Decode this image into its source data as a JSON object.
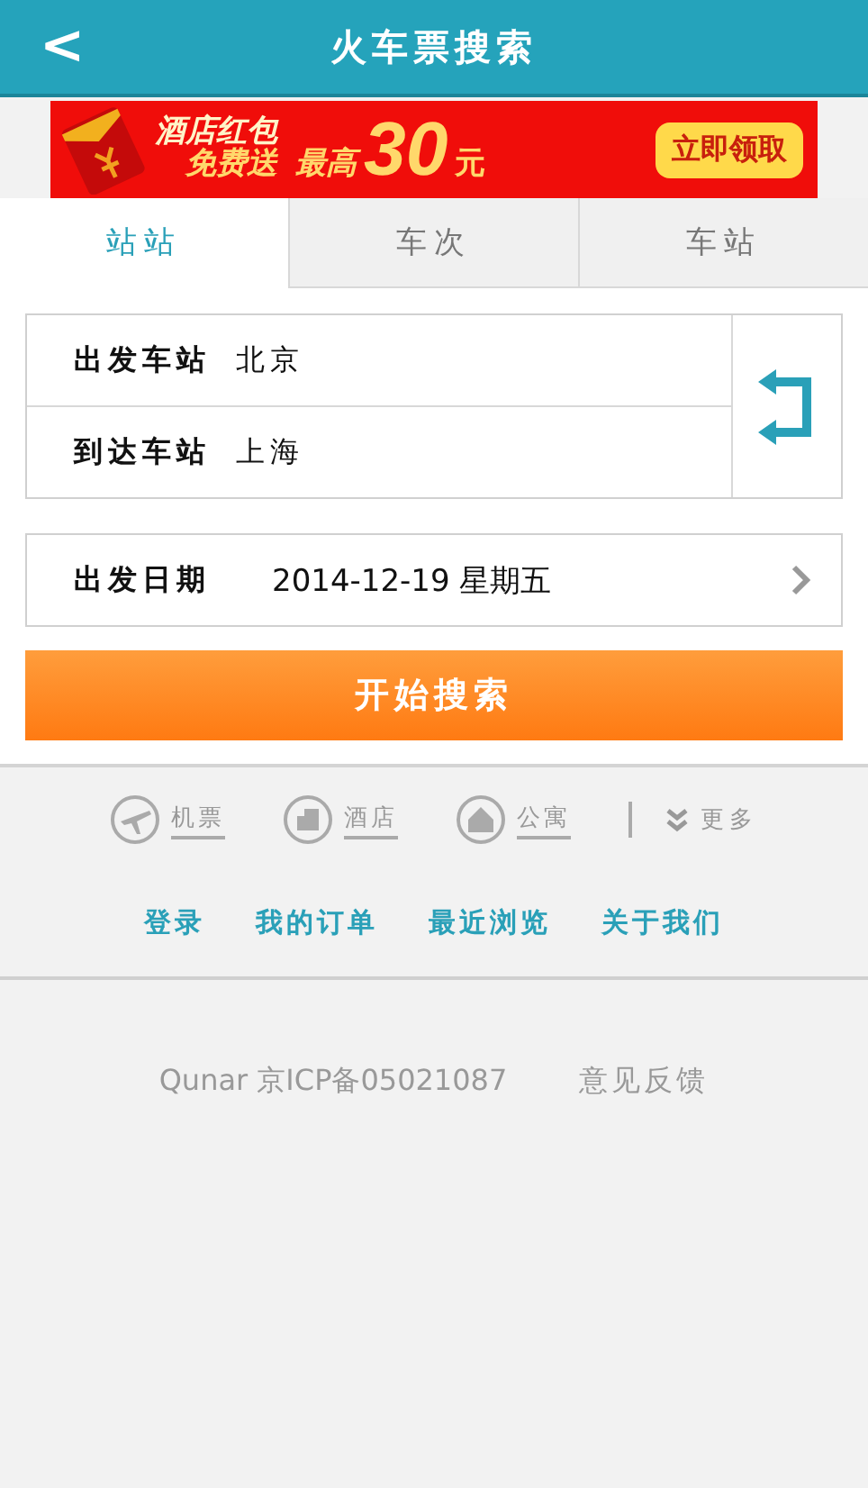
{
  "header": {
    "back": "<",
    "title": "火车票搜索"
  },
  "banner": {
    "line1": "酒店红包",
    "line2": "免费送",
    "prefix": "最高",
    "amount": "30",
    "unit": "元",
    "cta": "立即领取"
  },
  "tabs": [
    {
      "label": "站站",
      "selected": true
    },
    {
      "label": "车次",
      "selected": false
    },
    {
      "label": "车站",
      "selected": false
    }
  ],
  "form": {
    "from_label": "出发车站",
    "from_value": "北京",
    "to_label": "到达车站",
    "to_value": "上海",
    "date_label": "出发日期",
    "date_value": "2014-12-19 星期五"
  },
  "search_button": "开始搜索",
  "quick_links": [
    {
      "kind": "plane",
      "label": "机票"
    },
    {
      "kind": "hotel",
      "label": "酒店"
    },
    {
      "kind": "apartment",
      "label": "公寓"
    }
  ],
  "more": "更多",
  "nav_links": [
    "登录",
    "我的订单",
    "最近浏览",
    "关于我们"
  ],
  "footer": {
    "icp": "Qunar 京ICP备05021087",
    "feedback": "意见反馈"
  }
}
